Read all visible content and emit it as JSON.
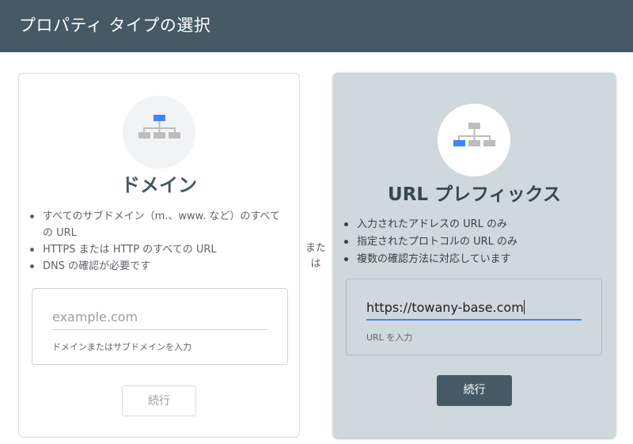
{
  "header": {
    "title": "プロパティ タイプの選択"
  },
  "domain_card": {
    "title": "ドメイン",
    "bullets": [
      "すべてのサブドメイン（m.、www. など）のすべての URL",
      "HTTPS または HTTP のすべての URL",
      "DNS の確認が必要です"
    ],
    "input": {
      "placeholder": "example.com",
      "helper": "ドメインまたはサブドメインを入力"
    },
    "button_label": "続行"
  },
  "separator": {
    "line1": "また",
    "line2": "は"
  },
  "url_card": {
    "title": "URL プレフィックス",
    "bullets": [
      "入力されたアドレスの URL のみ",
      "指定されたプロトコルの URL のみ",
      "複数の確認方法に対応しています"
    ],
    "input": {
      "value": "https://towany-base.com",
      "helper": "URL を入力"
    },
    "button_label": "続行"
  },
  "icons": {
    "domain": "sitemap-top-highlight-icon",
    "url": "sitemap-left-child-highlight-icon"
  },
  "colors": {
    "header_bg": "#455a64",
    "selected_card_bg": "#cfd8dc",
    "accent_blue": "#4285f4",
    "primary_button": "#455a64"
  }
}
